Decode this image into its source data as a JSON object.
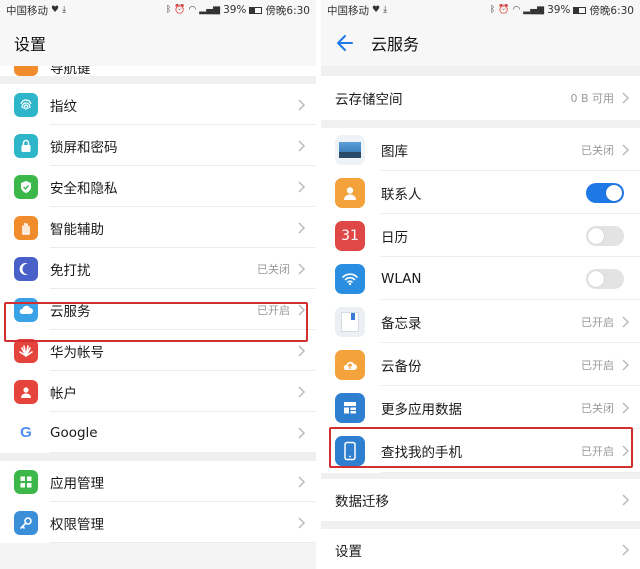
{
  "statusbar": {
    "carrier": "中国移动",
    "battery": "39%",
    "time": "傍晚6:30",
    "battery_level": 0.39
  },
  "left": {
    "title": "设置",
    "partial_item": "导航键",
    "items": [
      {
        "label": "指纹",
        "value": "",
        "icon": "fingerprint-icon",
        "color": "#2fb5c9"
      },
      {
        "label": "锁屏和密码",
        "value": "",
        "icon": "lock-icon",
        "color": "#2fb5c9"
      },
      {
        "label": "安全和隐私",
        "value": "",
        "icon": "shield-icon",
        "color": "#3cb84a"
      },
      {
        "label": "智能辅助",
        "value": "",
        "icon": "hand-icon",
        "color": "#f18c2d"
      },
      {
        "label": "免打扰",
        "value": "已关闭",
        "icon": "moon-icon",
        "color": "#4960c9"
      },
      {
        "label": "云服务",
        "value": "已开启",
        "icon": "cloud-icon",
        "color": "#3aa3e8"
      },
      {
        "label": "华为帐号",
        "value": "",
        "icon": "huawei-icon",
        "color": "#e5443c"
      },
      {
        "label": "帐户",
        "value": "",
        "icon": "account-icon",
        "color": "#e5443c"
      },
      {
        "label": "Google",
        "value": "",
        "icon": "google-icon",
        "color": "#4e8ef3"
      },
      {
        "label": "应用管理",
        "value": "",
        "icon": "apps-icon",
        "color": "#3cb84a"
      },
      {
        "label": "权限管理",
        "value": "",
        "icon": "key-icon",
        "color": "#3a8fd8"
      }
    ]
  },
  "right": {
    "title": "云服务",
    "storage": {
      "label": "云存储空间",
      "value": "0 B 可用"
    },
    "items": [
      {
        "label": "图库",
        "value": "已关闭",
        "control": "chevron",
        "icon": "gallery-icon"
      },
      {
        "label": "联系人",
        "value": "",
        "control": "toggle-on",
        "icon": "contacts-icon"
      },
      {
        "label": "日历",
        "value": "",
        "control": "toggle-off",
        "icon": "calendar-icon",
        "icon_text": "31"
      },
      {
        "label": "WLAN",
        "value": "",
        "control": "toggle-off",
        "icon": "wlan-icon"
      },
      {
        "label": "备忘录",
        "value": "已开启",
        "control": "chevron",
        "icon": "notes-icon"
      },
      {
        "label": "云备份",
        "value": "已开启",
        "control": "chevron",
        "icon": "cloud-backup-icon"
      },
      {
        "label": "更多应用数据",
        "value": "已关闭",
        "control": "chevron",
        "icon": "more-data-icon"
      },
      {
        "label": "查找我的手机",
        "value": "已开启",
        "control": "chevron",
        "icon": "find-phone-icon"
      }
    ],
    "migrate": "数据迁移",
    "settings": "设置"
  },
  "colors": {
    "accent": "#1e78e6",
    "highlight": "#d23030"
  }
}
